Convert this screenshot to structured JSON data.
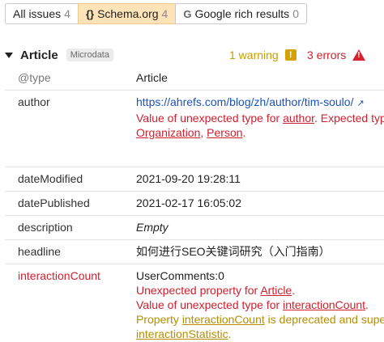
{
  "tabs": [
    {
      "label": "All issues",
      "count": "4"
    },
    {
      "label": "Schema.org",
      "count": "4"
    },
    {
      "label": "Google rich results",
      "count": "0"
    }
  ],
  "section": {
    "title": "Article",
    "badge": "Microdata",
    "warnings": "1 warning",
    "errors": "3 errors"
  },
  "rows": {
    "type": {
      "key": "@type",
      "value": "Article"
    },
    "author": {
      "key": "author",
      "value": "https://ahrefs.com/blog/zh/author/tim-soulo/",
      "msg_pre": "Value of unexpected type for ",
      "msg_link1": "author",
      "msg_mid": ". Expected typ",
      "msg_link2": "Organization",
      "msg_sep": ", ",
      "msg_link3": "Person",
      "msg_end": "."
    },
    "dateModified": {
      "key": "dateModified",
      "value": "2021-09-20 19:28:11"
    },
    "datePublished": {
      "key": "datePublished",
      "value": "2021-02-17 16:05:02"
    },
    "description": {
      "key": "description",
      "value": "Empty"
    },
    "headline": {
      "key": "headline",
      "value": "如何进行SEO关键词研究（入门指南）"
    },
    "interactionCount": {
      "key": "interactionCount",
      "value": "UserComments:0",
      "m1_pre": "Unexpected property for ",
      "m1_link": "Article",
      "m1_end": ".",
      "m2_pre": "Value of unexpected type for ",
      "m2_link": "interactionCount",
      "m2_end": ".",
      "m3_pre": "Property ",
      "m3_link": "interactionCount",
      "m3_mid": " is deprecated and supe",
      "m3_link2": "interactionStatistic",
      "m3_end": "."
    }
  },
  "icons": {
    "braces": "{}",
    "google": "G",
    "warning": "!",
    "error": "!"
  },
  "colors": {
    "active_tab": "#fde3b7",
    "error": "#d0202e",
    "warning": "#c79b00",
    "link": "#1a53b8"
  }
}
